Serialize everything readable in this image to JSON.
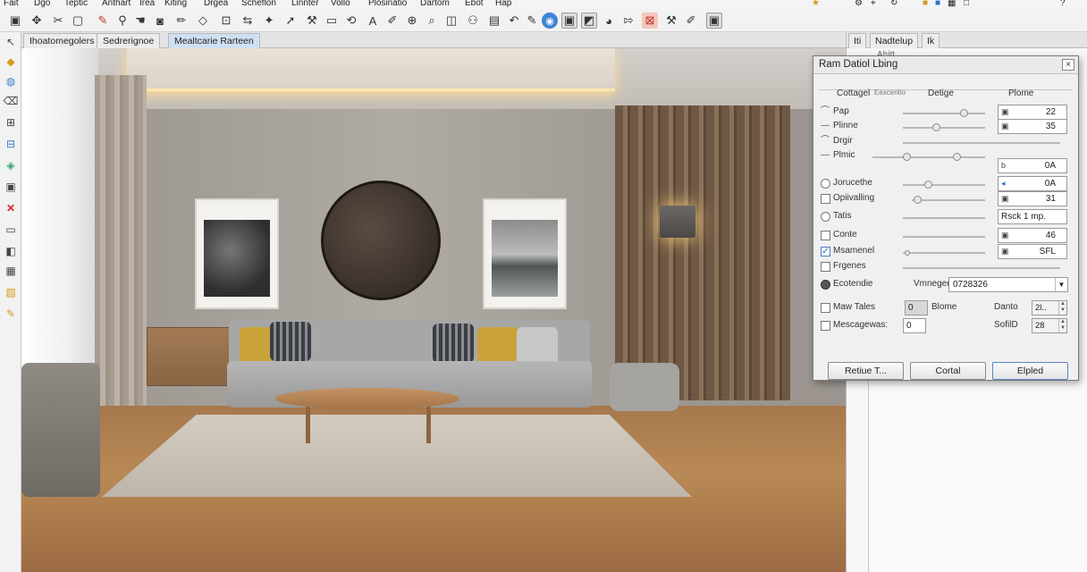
{
  "menu": [
    "Fait",
    "Dgo",
    "Teptic",
    "Anthart",
    "Irea",
    "Kiting",
    "Drgea",
    "Scheflon",
    "Linnter",
    "Vollo",
    "Plosinatio",
    "Dartom",
    "Ebot",
    "Hap"
  ],
  "tabs": [
    {
      "label": "Ihoatomegolers"
    },
    {
      "label": "Sedrerignoe"
    },
    {
      "label": "Mealtcarie Rarteen"
    }
  ],
  "right_panel": {
    "tab_a": "Iti",
    "tab_b": "Nadtelup",
    "tab_c": "Ik",
    "sub": "Ahitt..."
  },
  "dialog": {
    "title": "Ram Datiol Lbing",
    "close": "×",
    "headers": {
      "col1": "Cottagel",
      "col1b": "Eexcentio",
      "col2": "Detige",
      "col3": "Plome"
    },
    "rows": [
      {
        "label": "Pap",
        "mark": "arc",
        "value": "22",
        "icon": "▣",
        "thumb_pct": 70
      },
      {
        "label": "Plinne",
        "mark": "dash",
        "value": "35",
        "icon": "▣",
        "thumb_pct": 38
      },
      {
        "label": "Drgir",
        "mark": "arc",
        "value": "",
        "icon": "",
        "thumb_pct": null
      },
      {
        "label": "Plmic",
        "mark": "dash",
        "value": "",
        "icon": "",
        "thumb_pct": 55
      },
      {
        "label": "Jorucethe",
        "mark": "radio",
        "value": "0A",
        "icon": "b",
        "thumb_pct": 30
      },
      {
        "label": "Opiivalling",
        "mark": "check",
        "value": "0A",
        "icon": "◂",
        "thumb_pct": 15
      },
      {
        "label": "Tatis",
        "mark": "radio",
        "value": "31",
        "icon": "▣",
        "thumb_pct": null
      },
      {
        "label": "Conte",
        "mark": "check",
        "value": "Rsck 1 mp.",
        "icon": "",
        "thumb_pct": null
      },
      {
        "label": "Msamenel",
        "mark": "checked",
        "value": "46",
        "icon": "▣",
        "thumb_pct": null
      },
      {
        "label": "Frgenes",
        "mark": "check",
        "value": "SFL",
        "icon": "▣",
        "thumb_pct": 2
      }
    ],
    "ecotendie": {
      "label": "Ecotendie",
      "field_label": "Vmneger",
      "value": "0728326"
    },
    "maw_tales": {
      "label": "Maw Tales",
      "box": "0",
      "label2": "Blome",
      "label3": "Danto",
      "spin": "2l.."
    },
    "messagewas": {
      "label": "Mescagewas:",
      "box": "0",
      "label3": "SofilD",
      "spin": "28"
    },
    "buttons": {
      "retire": "Retiue T...",
      "cancel": "Cortal",
      "apply": "Elpled"
    }
  }
}
